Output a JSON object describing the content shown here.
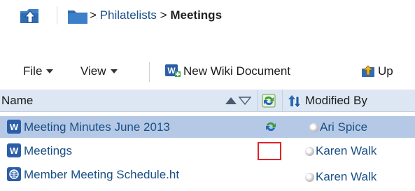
{
  "breadcrumb": {
    "separator": ">",
    "parent": "Philatelists",
    "current": "Meetings"
  },
  "toolbar": {
    "file_label": "File",
    "view_label": "View",
    "new_wiki_label": "New Wiki Document",
    "upload_label": "Up"
  },
  "table": {
    "headers": {
      "name": "Name",
      "modified_by": "Modified By"
    },
    "rows": [
      {
        "name": "Meeting Minutes June 2013",
        "modified_by": "Ari Spice",
        "file_type": "word",
        "selected": true,
        "has_status": true
      },
      {
        "name": "Meetings",
        "modified_by": "Karen Walk",
        "file_type": "word",
        "selected": false,
        "has_status": false
      },
      {
        "name": "Member Meeting Schedule.ht",
        "modified_by": "Karen Walk",
        "file_type": "html",
        "selected": false,
        "has_status": false
      }
    ]
  },
  "colors": {
    "link": "#1a4f86",
    "selected_row": "#b5c9e6",
    "header_row": "#dde7f3",
    "highlight": "#e2222a"
  }
}
